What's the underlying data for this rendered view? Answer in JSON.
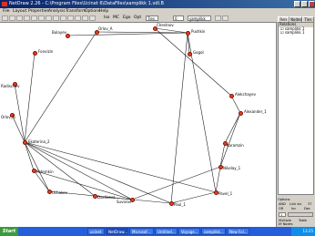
{
  "window": {
    "title": "NetDraw 2.26 - C:\\Program Files\\Ucinet 6\\DataFiles\\samplikk 1.vdl.B"
  },
  "menu": [
    "File",
    "Layout",
    "Properties",
    "Analysis",
    "Transform",
    "Options",
    "Help"
  ],
  "toolbar": {
    "iso_label": "Iso",
    "mc_label": "MC",
    "ego_label": "Ego",
    "opt_label": "Opt",
    "ties_label": "Ties",
    "value_label": "0",
    "dataset_value": "samplikk 1.vdl"
  },
  "nodes": [
    {
      "label": "Orlov_A"
    },
    {
      "label": "Bulayev"
    },
    {
      "label": "Chestnov"
    },
    {
      "label": "Pushkin"
    },
    {
      "label": "Gogol"
    },
    {
      "label": "Fonvizin"
    },
    {
      "label": "Radischev"
    },
    {
      "label": "Orlov_G"
    },
    {
      "label": "Ekaterina_2"
    },
    {
      "label": "Alekchayev"
    },
    {
      "label": "Alexander_1"
    },
    {
      "label": "Karamzin"
    },
    {
      "label": "Nikolay_1"
    },
    {
      "label": "Potemkin"
    },
    {
      "label": "Pavel_1"
    },
    {
      "label": "Ushakov"
    },
    {
      "label": "Paul_1"
    },
    {
      "label": "Dashkova"
    },
    {
      "label": "Suvorov"
    }
  ],
  "side_panel": {
    "tabs": [
      "Rels",
      "Nodes",
      "Ties"
    ],
    "list_header": "Relations",
    "list_items": [
      "samplikk 1",
      "samplikk 1"
    ],
    "options_label": "Options",
    "and_label": "AND",
    "link_label": "Link vis",
    "link_value": "37",
    "or_label": "OR",
    "inc_label": "Inc",
    "dec_label": "Dec",
    "slider_value": "1",
    "multiple_label": "Multiple",
    "table_label": "Table",
    "node_count": "19 Nodes"
  },
  "taskbar": {
    "start_label": "Start",
    "tasks": [
      "ucinet",
      "NetDraw...",
      "Microsof...",
      "Untitled...",
      "Voyage...",
      "samplikk...",
      "New Fol..."
    ],
    "clock": "13:25"
  },
  "colors": {
    "node_fill": "#e84020",
    "edge": "#202020",
    "title_bar": "#0a246a",
    "taskbar": "#245edb"
  }
}
